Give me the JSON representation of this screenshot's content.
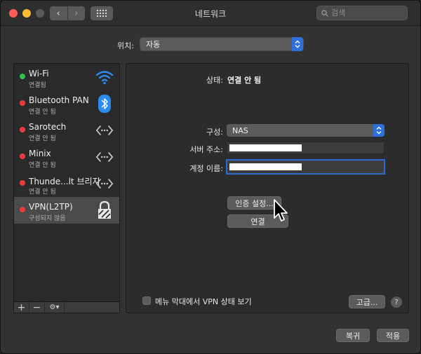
{
  "window": {
    "title": "네트워크",
    "search_placeholder": "검색",
    "nav_back": "‹",
    "nav_forward": "›"
  },
  "location": {
    "label": "위치:",
    "value": "자동"
  },
  "services": [
    {
      "name": "Wi-Fi",
      "status": "연결됨",
      "dot_color": "#2ec44a",
      "icon": "wifi-icon"
    },
    {
      "name": "Bluetooth PAN",
      "status": "연결 안 됨",
      "dot_color": "#ee3c3c",
      "icon": "bluetooth-icon"
    },
    {
      "name": "Sarotech",
      "status": "연결 안 됨",
      "dot_color": "#ee3c3c",
      "icon": "ethernet-icon"
    },
    {
      "name": "Minix",
      "status": "연결 안 됨",
      "dot_color": "#ee3c3c",
      "icon": "ethernet-icon"
    },
    {
      "name": "Thunde...lt 브리지",
      "status": "연결 안 됨",
      "dot_color": "#ee3c3c",
      "icon": "ethernet-icon"
    },
    {
      "name": "VPN(L2TP)",
      "status": "구성되지 않음",
      "dot_color": "#ee3c3c",
      "icon": "lock-icon"
    }
  ],
  "sidebar_tools": {
    "add": "+",
    "remove": "−",
    "gear": "⚙▾"
  },
  "detail": {
    "status_label": "상태:",
    "status_value": "연결 안 됨",
    "config_label": "구성:",
    "config_value": "NAS",
    "server_label": "서버 주소:",
    "account_label": "계정 이름:",
    "auth_button": "인증 설정...",
    "connect_button": "연결",
    "show_status_label": "메뉴 막대에서 VPN 상태 보기",
    "advanced_button": "고급...",
    "help": "?"
  },
  "footer": {
    "revert_button": "복귀",
    "apply_button": "적용"
  },
  "colors": {
    "accent": "#2f6fdc",
    "connected": "#2ec44a",
    "disconnected": "#ee3c3c"
  }
}
